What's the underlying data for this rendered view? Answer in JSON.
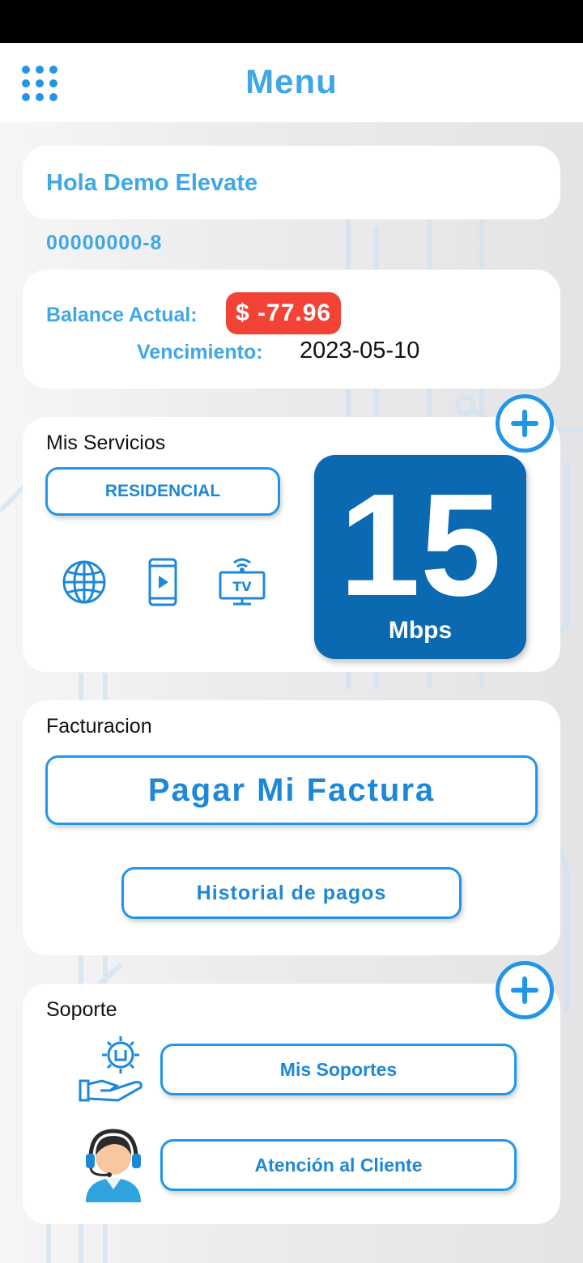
{
  "app_bar": {
    "title": "Menu",
    "menu_icon": "grid-menu-icon"
  },
  "greeting": {
    "text": "Hola Demo Elevate"
  },
  "client_id": "00000000-8",
  "balance": {
    "label": "Balance Actual:",
    "amount": "$ -77.96",
    "due_label": "Vencimiento:",
    "due_date": "2023-05-10",
    "badge_color": "#f24336"
  },
  "services": {
    "title": "Mis Servicios",
    "plan_button": "RESIDENCIAL",
    "icons": [
      "globe-icon",
      "mobile-play-icon",
      "tv-wifi-icon"
    ],
    "speed_value": "15",
    "speed_unit": "Mbps",
    "speed_box_color": "#0a69b1"
  },
  "billing": {
    "title": "Facturacion",
    "pay_button": "Pagar Mi Factura",
    "history_button": "Historial de pagos"
  },
  "support": {
    "title": "Soporte",
    "my_supports_button": "Mis Soportes",
    "customer_service_button": "Atención al Cliente"
  },
  "colors": {
    "accent": "#2196e8",
    "title_blue": "#3fa7e6"
  }
}
